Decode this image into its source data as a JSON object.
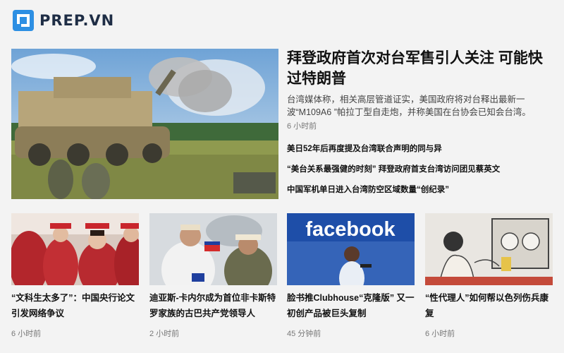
{
  "brand": {
    "name": "PREP.VN",
    "colors": {
      "primary": "#2d8fe3",
      "dark": "#1e2d45",
      "text": "#111111",
      "muted": "#777777"
    }
  },
  "hero": {
    "title": "拜登政府首次对台军售引人关注 可能快过特朗普",
    "summary": "台湾媒体称，相关高层管道证实，美国政府将对台释出最新一波“M109A6 ”帕拉丁型自走炮，并称美国在台协会已知会台湾。",
    "time": "6 小时前",
    "image": "self-propelled-howitzer-photo"
  },
  "related": [
    {
      "title": "美日52年后再度提及台湾联合声明的同与异"
    },
    {
      "title": "“美台关系最强健的时刻” 拜登政府首支台湾访问团见蔡英文"
    },
    {
      "title": "中国军机单日进入台湾防空区域数量“创纪录”"
    }
  ],
  "cards": [
    {
      "title": "“文科生太多了”：中国央行论文引发网络争议",
      "time": "6 小时前",
      "image": "graduates-photo"
    },
    {
      "title": "迪亚斯-卡内尔成为首位非卡斯特罗家族的古巴共产党领导人",
      "time": "2 小时前",
      "image": "cuban-leaders-photo"
    },
    {
      "title": "脸书推Clubhouse“克隆版” 又一初创产品被巨头复制",
      "time": "45 分钟前",
      "image": "facebook-logo-photo",
      "image_text": "facebook"
    },
    {
      "title": "“性代理人”如何帮以色列伤兵康复",
      "time": "6 小时前",
      "image": "illustration-photo"
    }
  ]
}
